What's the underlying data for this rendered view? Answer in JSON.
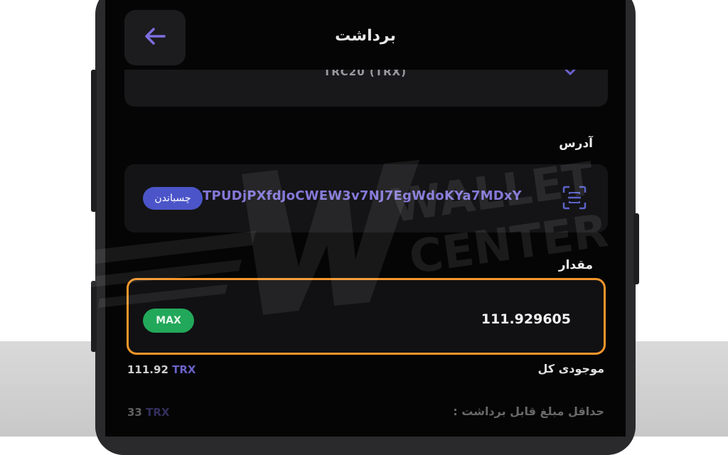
{
  "header": {
    "title": "برداشت",
    "back_icon": "arrow-left-icon"
  },
  "network": {
    "selected": "TRC20 (TRX)"
  },
  "address": {
    "label": "آدرس",
    "value": "TPUDjPXfdJoCWEW3v7NJ7EgWdoKYa7MDxY",
    "paste_label": "چسباندن",
    "scan_icon": "qr-scan-icon"
  },
  "amount": {
    "label": "مقدار",
    "value": "111.929605",
    "max_label": "MAX"
  },
  "balance": {
    "label": "موجودی کل",
    "value": "111.92",
    "unit": "TRX"
  },
  "min_withdraw": {
    "label": "حداقل مبلغ قابل برداشت :",
    "value": "33",
    "unit": "TRX"
  },
  "watermark": {
    "line1": "WALLET",
    "line2": "CENTER"
  },
  "colors": {
    "accent": "#4b55c9",
    "address_text": "#8378d8",
    "highlight_border": "#f5962a",
    "max_green": "#22a85a"
  }
}
